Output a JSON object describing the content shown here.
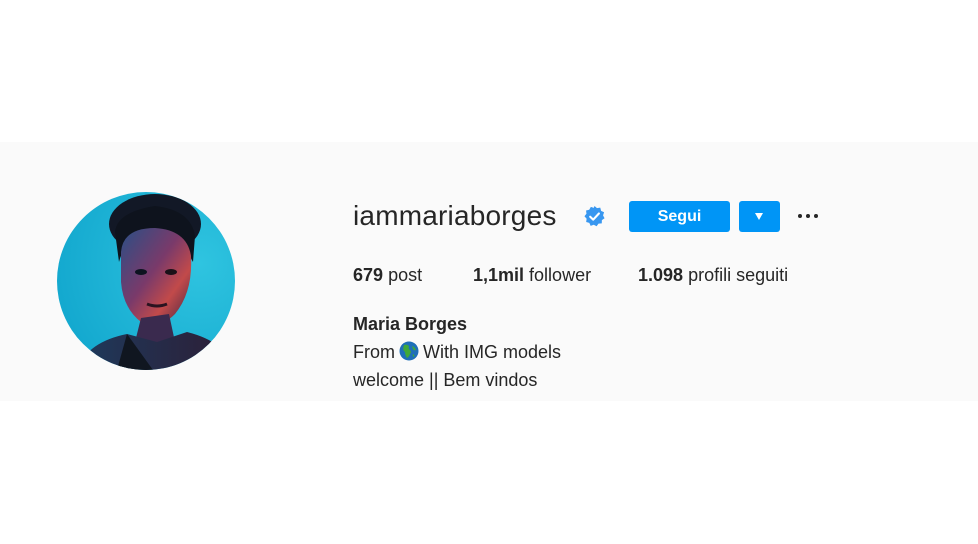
{
  "profile": {
    "username": "iammariaborges",
    "verified": true,
    "follow_label": "Segui",
    "dropdown_icon": "caret-down-icon",
    "more_icon": "more-options-icon",
    "stats": {
      "posts_count": "679",
      "posts_label": "post",
      "followers_count": "1,1mil",
      "followers_label": "follower",
      "following_count": "1.098",
      "following_label": "profili seguiti"
    },
    "full_name": "Maria Borges",
    "bio": {
      "line1_prefix": "From",
      "line1_emoji": "globe-icon",
      "line1_suffix": "With IMG models",
      "line2": "welcome || Bem vindos"
    }
  },
  "colors": {
    "accent": "#0095f6",
    "verified_badge": "#3897f0",
    "band_background": "#fafafa",
    "text": "#262626"
  }
}
